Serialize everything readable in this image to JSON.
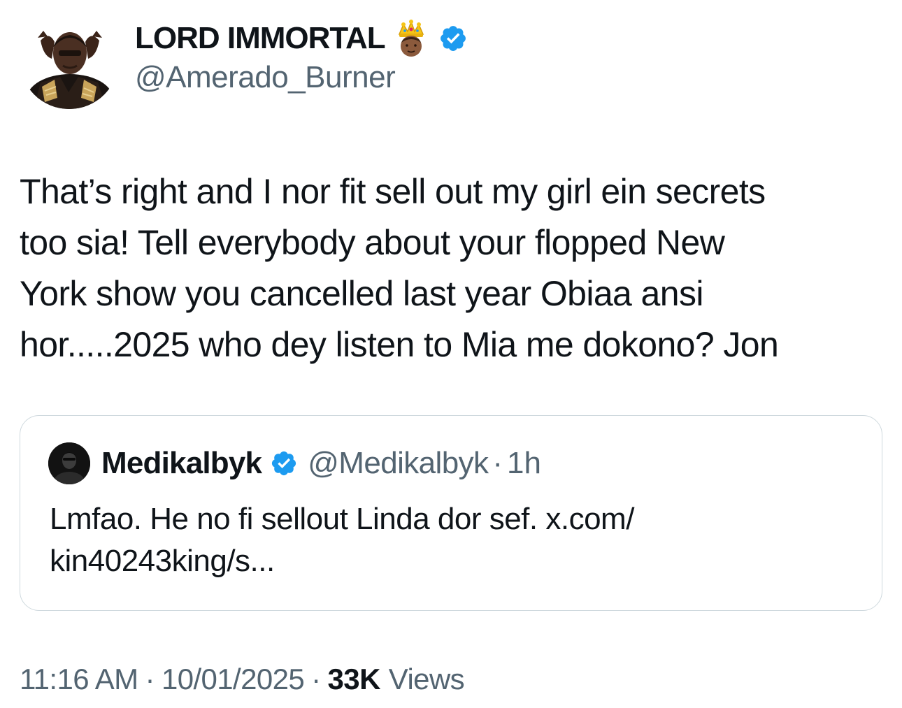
{
  "author": {
    "display_name": "LORD IMMORTAL",
    "handle": "@Amerado_Burner",
    "avatar_icon": "avatar-photo",
    "badge_icon": "crown-emoji-icon",
    "verified_icon": "verified-badge-icon"
  },
  "tweet": {
    "text": "That’s right and I nor fit sell out my girl ein secrets\ntoo sia! Tell everybody about your flopped New\nYork show you cancelled last year Obiaa ansi\nhor.....2025 who dey listen to Mia me dokono? Jon"
  },
  "quote": {
    "display_name": "Medikalbyk",
    "handle": "@Medikalbyk",
    "separator": "·",
    "time": "1h",
    "text": "Lmfao. He no fi sellout Linda dor sef. x.com/\nkin40243king/s..."
  },
  "meta": {
    "time": "11:16 AM",
    "separator": "·",
    "date": "10/01/2025",
    "views_count": "33K",
    "views_label": "Views"
  },
  "colors": {
    "verified_blue": "#1d9bf0",
    "secondary_text": "#536471",
    "primary_text": "#0f1419",
    "card_border": "#cfd9de"
  }
}
